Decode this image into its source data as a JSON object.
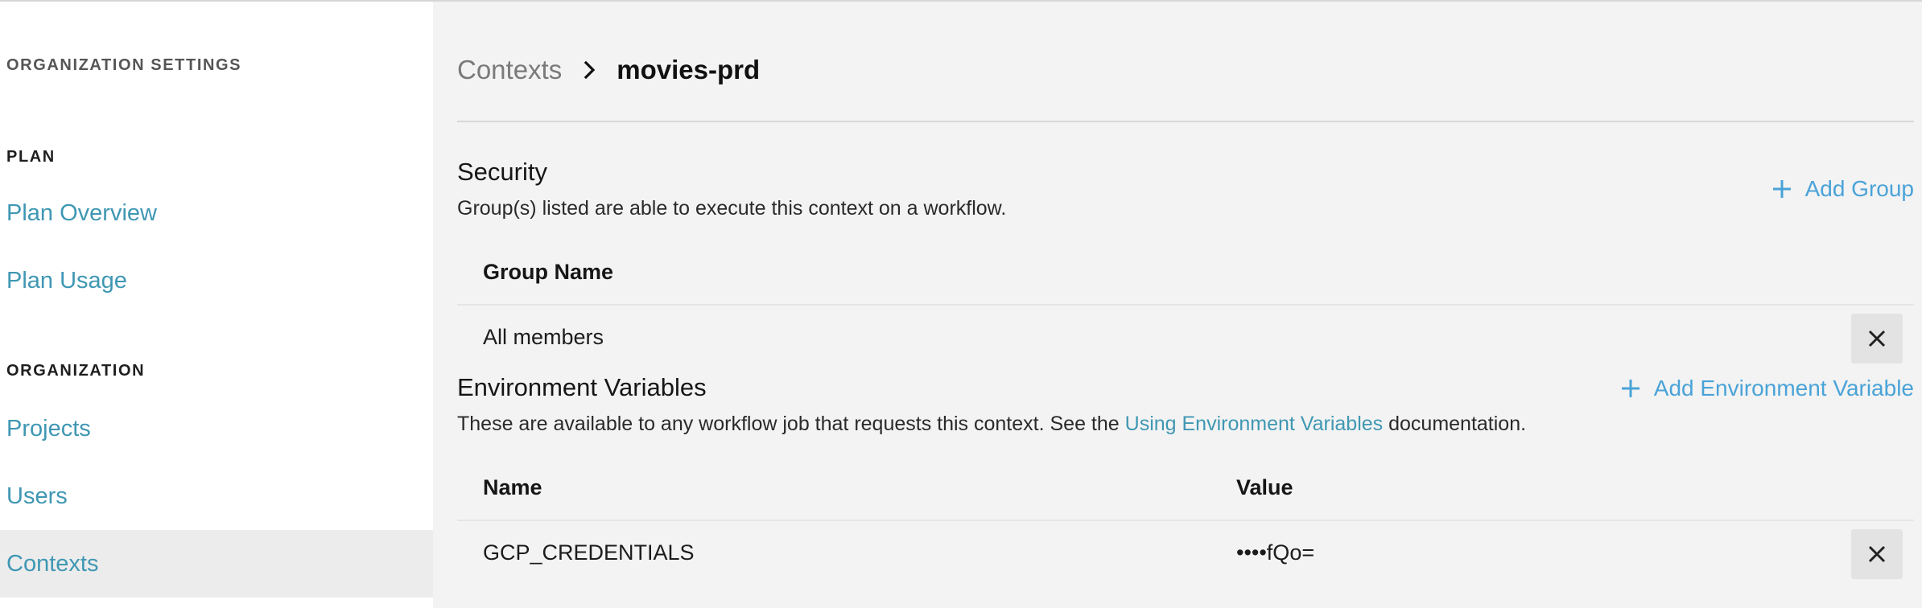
{
  "sidebar": {
    "org_settings_heading": "ORGANIZATION SETTINGS",
    "plan_heading": "PLAN",
    "plan_overview": "Plan Overview",
    "plan_usage": "Plan Usage",
    "organization_heading": "ORGANIZATION",
    "projects": "Projects",
    "users": "Users",
    "contexts": "Contexts",
    "active_item": "Contexts"
  },
  "breadcrumb": {
    "parent": "Contexts",
    "current": "movies-prd"
  },
  "security": {
    "title": "Security",
    "description": "Group(s) listed are able to execute this context on a workflow.",
    "add_button": "Add Group",
    "column_group_name": "Group Name",
    "rows": [
      {
        "group_name": "All members"
      }
    ]
  },
  "env_vars": {
    "title": "Environment Variables",
    "description_before": "These are available to any workflow job that requests this context. See the ",
    "description_link": "Using Environment Variables",
    "description_after": " documentation.",
    "add_button": "Add Environment Variable",
    "column_name": "Name",
    "column_value": "Value",
    "rows": [
      {
        "name": "GCP_CREDENTIALS",
        "value": "••••fQo="
      }
    ]
  },
  "icons": {
    "breadcrumb_separator": "chevron-right-icon",
    "add": "plus-icon",
    "delete": "close-icon"
  },
  "colors": {
    "link": "#3f97b3",
    "action": "#4aa3d8",
    "sidebar_bg": "#ffffff",
    "main_bg": "#f3f3f3",
    "active_item_bg": "#ececec"
  }
}
